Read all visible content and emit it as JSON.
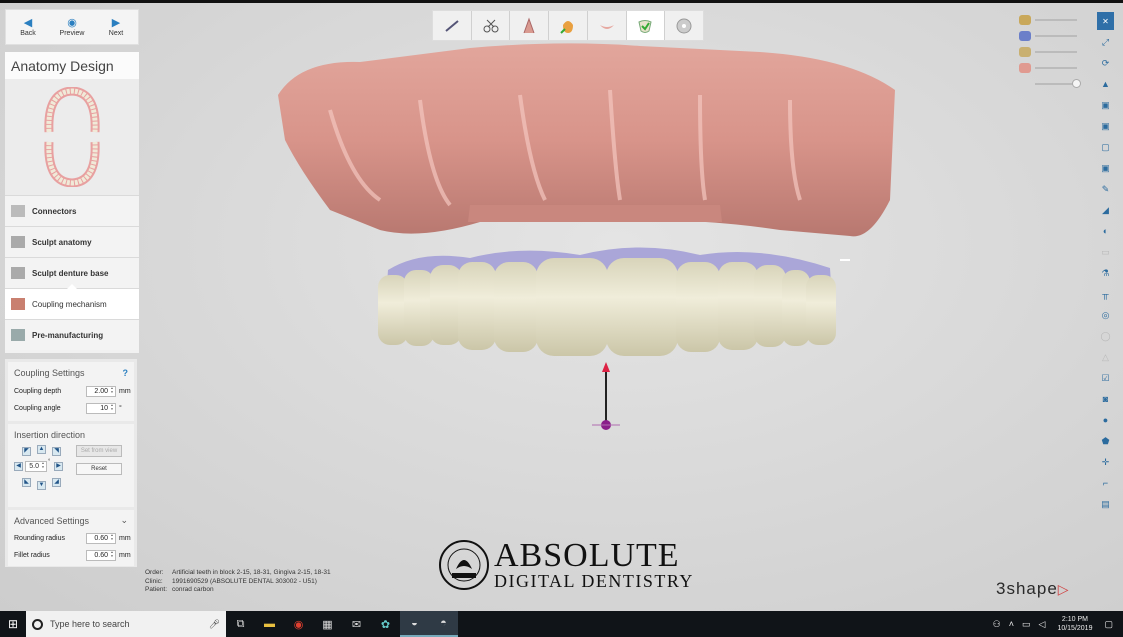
{
  "nav": {
    "back": "Back",
    "preview": "Preview",
    "next": "Next"
  },
  "panel": {
    "title": "Anatomy Design",
    "steps": [
      {
        "label": "Connectors"
      },
      {
        "label": "Sculpt anatomy"
      },
      {
        "label": "Sculpt denture base"
      },
      {
        "label": "Coupling mechanism"
      },
      {
        "label": "Pre-manufacturing"
      }
    ]
  },
  "coupling": {
    "title": "Coupling Settings",
    "help": "?",
    "depth_label": "Coupling depth",
    "depth_value": "2.00",
    "depth_unit": "mm",
    "angle_label": "Coupling angle",
    "angle_value": "10",
    "angle_unit": "°"
  },
  "insertion": {
    "title": "Insertion direction",
    "step_value": "5.0",
    "step_unit": "°",
    "set_from_view": "Set from view",
    "reset": "Reset"
  },
  "advanced": {
    "title": "Advanced Settings",
    "rounding_label": "Rounding radius",
    "rounding_value": "0.60",
    "rounding_unit": "mm",
    "fillet_label": "Fillet radius",
    "fillet_value": "0.60",
    "fillet_unit": "mm"
  },
  "info": {
    "order_key": "Order:",
    "order_val": "Artificial teeth in block 2-15, 18-31, Gingiva 2-15, 18-31",
    "clinic_key": "Clinic:",
    "clinic_val": "1991690529 (ABSOLUTE DENTAL 303002 - U51)",
    "patient_key": "Patient:",
    "patient_val": "conrad carbon"
  },
  "logo": {
    "line1": "ABSOLUTE",
    "line2": "DIGITAL DENTISTRY"
  },
  "brand": "3shape",
  "taskbar": {
    "search_placeholder": "Type here to search",
    "time": "2:10 PM",
    "date": "10/15/2019"
  },
  "colors": {
    "accent": "#2a7fc0",
    "gingiva": "#d99a90",
    "teeth": "#e6e2cc",
    "taskbar": "#101418"
  }
}
